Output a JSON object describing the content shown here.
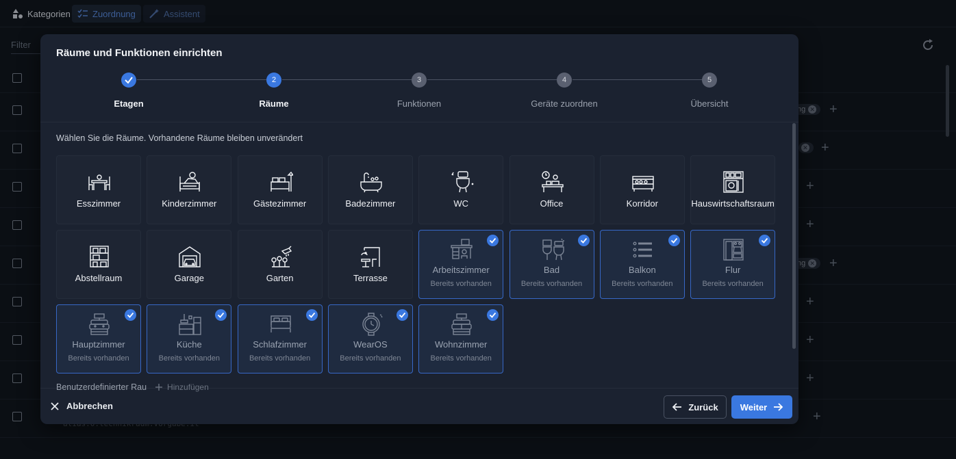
{
  "app": {
    "tabs": [
      {
        "label": "Kategorien",
        "icon": "shapes-icon"
      },
      {
        "label": "Zuordnung",
        "icon": "list-check-icon"
      },
      {
        "label": "Assistent",
        "icon": "magic-wand-icon"
      }
    ],
    "filter_placeholder": "Filter",
    "chips": [
      "ng",
      "ng"
    ],
    "code_snippet": "alias.0.technikraum.Vorgabe.it"
  },
  "dialog": {
    "title": "Räume und Funktionen einrichten",
    "steps": [
      {
        "number": "1",
        "label": "Etagen",
        "state": "done"
      },
      {
        "number": "2",
        "label": "Räume",
        "state": "current"
      },
      {
        "number": "3",
        "label": "Funktionen",
        "state": "todo"
      },
      {
        "number": "4",
        "label": "Geräte zuordnen",
        "state": "todo"
      },
      {
        "number": "5",
        "label": "Übersicht",
        "state": "todo"
      }
    ],
    "instruction": "Wählen Sie die Räume. Vorhandene Räume bleiben unverändert",
    "existing_label": "Bereits vorhanden",
    "rooms": [
      {
        "label": "Esszimmer",
        "icon": "dining-table-icon",
        "selected": false
      },
      {
        "label": "Kinderzimmer",
        "icon": "child-bed-icon",
        "selected": false
      },
      {
        "label": "Gästezimmer",
        "icon": "guest-bed-icon",
        "selected": false
      },
      {
        "label": "Badezimmer",
        "icon": "bathtub-icon",
        "selected": false
      },
      {
        "label": "WC",
        "icon": "toilet-icon",
        "selected": false
      },
      {
        "label": "Office",
        "icon": "office-desk-icon",
        "selected": false
      },
      {
        "label": "Korridor",
        "icon": "corridor-icon",
        "selected": false
      },
      {
        "label": "Hauswirtschaftsraum",
        "icon": "laundry-icon",
        "selected": false
      },
      {
        "label": "Abstellraum",
        "icon": "storage-shelf-icon",
        "selected": false
      },
      {
        "label": "Garage",
        "icon": "garage-icon",
        "selected": false
      },
      {
        "label": "Garten",
        "icon": "garden-icon",
        "selected": false
      },
      {
        "label": "Terrasse",
        "icon": "terrace-icon",
        "selected": false
      },
      {
        "label": "Arbeitszimmer",
        "icon": "workroom-icon",
        "selected": true
      },
      {
        "label": "Bad",
        "icon": "bathroom-icon",
        "selected": true
      },
      {
        "label": "Balkon",
        "icon": "list-lines-icon",
        "selected": true
      },
      {
        "label": "Flur",
        "icon": "hallway-icon",
        "selected": true
      },
      {
        "label": "Hauptzimmer",
        "icon": "main-room-icon",
        "selected": true
      },
      {
        "label": "Küche",
        "icon": "kitchen-icon",
        "selected": true
      },
      {
        "label": "Schlafzimmer",
        "icon": "bed-icon",
        "selected": true
      },
      {
        "label": "WearOS",
        "icon": "watch-icon",
        "selected": true
      },
      {
        "label": "Wohnzimmer",
        "icon": "living-room-icon",
        "selected": true
      }
    ],
    "custom_label": "Benutzerdefinierter Rau",
    "add_label": "Hinzufügen",
    "cancel_label": "Abbrechen",
    "back_label": "Zurück",
    "next_label": "Weiter"
  }
}
